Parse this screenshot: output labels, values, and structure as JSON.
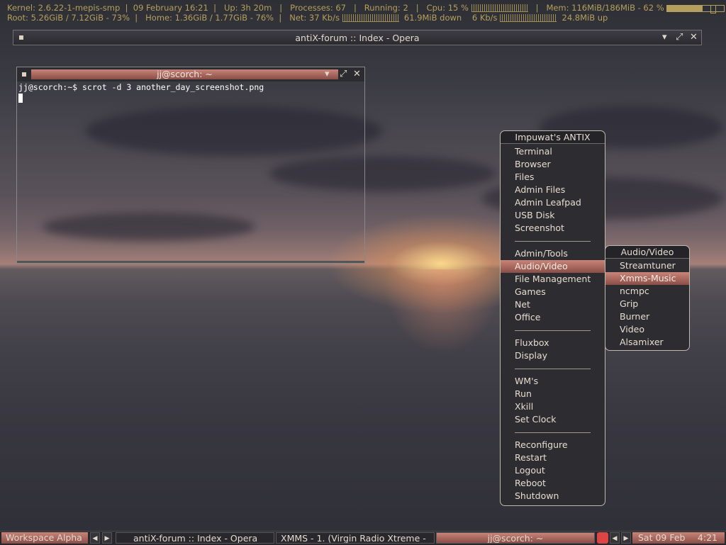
{
  "conky": {
    "line1": {
      "kernel": "Kernel: 2.6.22-1-mepis-smp",
      "date": "09 February 16:21",
      "uptime": "Up: 3h 20m",
      "processes": "Processes: 67",
      "running": "Running: 2",
      "cpu": "Cpu: 15 %",
      "mem": "Mem: 116MiB/186MiB - 62 %",
      "mem_percent": 62
    },
    "line2": {
      "root": "Root: 5.26GiB  / 7.12GiB - 73%",
      "home": "Home: 1.36GiB  / 1.77GiB  - 76%",
      "net_down_rate": "Net: 37   Kb/s",
      "down_total": "61.9MiB down",
      "net_up_rate": "6    Kb/s",
      "up_total": "24.8MiB up"
    }
  },
  "opera_window": {
    "title": "antiX-forum :: Index - Opera"
  },
  "terminal": {
    "title": "jj@scorch: ~",
    "command_line": "jj@scorch:~$ scrot -d 3 another_day_screenshot.png"
  },
  "root_menu": {
    "title": "Impuwat's ANTIX",
    "groups": [
      [
        "Terminal",
        "Browser",
        "Files",
        "Admin Files",
        "Admin Leafpad",
        "USB Disk",
        "Screenshot"
      ],
      [
        "Admin/Tools",
        "Audio/Video",
        "File Management",
        "Games",
        "Net",
        "Office"
      ],
      [
        "Fluxbox",
        "Display"
      ],
      [
        "WM's",
        "Run",
        "Xkill",
        "Set Clock"
      ],
      [
        "Reconfigure",
        "Restart",
        "Logout",
        "Reboot",
        "Shutdown"
      ]
    ],
    "active_item": "Audio/Video"
  },
  "submenu": {
    "title": "Audio/Video",
    "items": [
      "Streamtuner",
      "Xmms-Music",
      "ncmpc",
      "Grip",
      "Burner",
      "Video",
      "Alsamixer"
    ],
    "active_item": "Xmms-Music"
  },
  "taskbar": {
    "workspace": "Workspace Alpha",
    "tasks": [
      "antiX-forum :: Index - Opera",
      "XMMS - 1.  (Virgin Radio Xtreme -",
      "jj@scorch: ~"
    ],
    "focused_task": "jj@scorch: ~",
    "clock_date": "Sat 09 Feb",
    "clock_time": "4:21"
  },
  "colors": {
    "accent": "#b07068",
    "conky_text": "#b59f5c",
    "menu_bg": "#2d2c31"
  }
}
